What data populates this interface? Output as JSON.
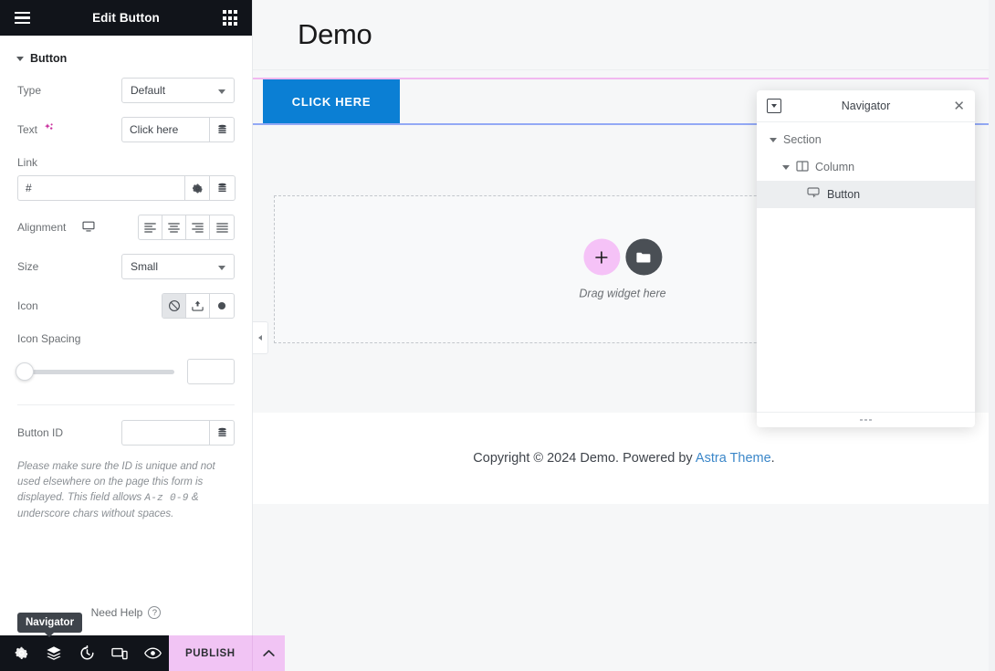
{
  "panel": {
    "title": "Edit Button",
    "menu_icon": "hamburger-icon",
    "widgets_icon": "widgets-grid-icon",
    "section": {
      "label": "Button"
    },
    "controls": {
      "type": {
        "label": "Type",
        "value": "Default"
      },
      "text": {
        "label": "Text",
        "value": "Click here",
        "placeholder": "Click here",
        "ai_icon": "ai-sparkle-icon",
        "dynamic_icon": "dynamic-tags-icon"
      },
      "link": {
        "label": "Link",
        "value": "#",
        "placeholder": "#",
        "settings_icon": "gear-icon",
        "dynamic_icon": "dynamic-tags-icon"
      },
      "alignment": {
        "label": "Alignment",
        "device_icon": "desktop-icon",
        "options": [
          "align-left",
          "align-center",
          "align-right",
          "align-justify"
        ],
        "selected": ""
      },
      "size": {
        "label": "Size",
        "value": "Small"
      },
      "icon": {
        "label": "Icon",
        "options": [
          "none-icon",
          "upload-icon",
          "icon-library-icon"
        ],
        "selected": "none-icon"
      },
      "icon_spacing": {
        "label": "Icon Spacing",
        "value": "",
        "placeholder": ""
      },
      "button_id": {
        "label": "Button ID",
        "value": "",
        "placeholder": "",
        "dynamic_icon": "dynamic-tags-icon"
      },
      "button_id_note_1": "Please make sure the ID is unique and not used",
      "button_id_note_2": "elsewhere on the page this form is displayed.",
      "button_id_note_3a": "This field allows ",
      "button_id_note_3b": "A-z  0-9",
      "button_id_note_3c": " & underscore chars",
      "button_id_note_4": "without spaces."
    },
    "need_help": {
      "label": "Need Help",
      "icon": "question-circle-icon"
    },
    "tooltip": "Navigator",
    "footer": {
      "icons": [
        "settings-gear-icon",
        "navigator-layers-icon",
        "history-clock-icon",
        "responsive-device-icon",
        "preview-eye-icon"
      ],
      "publish_label": "PUBLISH",
      "publish_caret_icon": "chevron-up-icon",
      "publish_color": "#f1c4f4"
    }
  },
  "canvas": {
    "site_title": "Demo",
    "cta_button": {
      "label": "CLICK HERE",
      "color": "#0b7fd4"
    },
    "dropzone": {
      "add_icon": "plus-icon",
      "folder_icon": "folder-icon",
      "text": "Drag widget here"
    },
    "footer": {
      "copyright_prefix": "Copyright © 2024 Demo. Powered by ",
      "link_text": "Astra Theme",
      "suffix": "."
    },
    "collapse_handle_icon": "chevron-left-icon"
  },
  "navigator": {
    "title": "Navigator",
    "dock_icon": "dock-toggle-icon",
    "close_icon": "close-icon",
    "tree": [
      {
        "label": "Section",
        "depth": 1,
        "selected": false
      },
      {
        "label": "Column",
        "depth": 2,
        "selected": false,
        "icon": "column-icon"
      },
      {
        "label": "Button",
        "depth": 3,
        "selected": true,
        "icon": "button-widget-icon"
      }
    ],
    "resize_handle_icon": "resize-dots-icon"
  }
}
